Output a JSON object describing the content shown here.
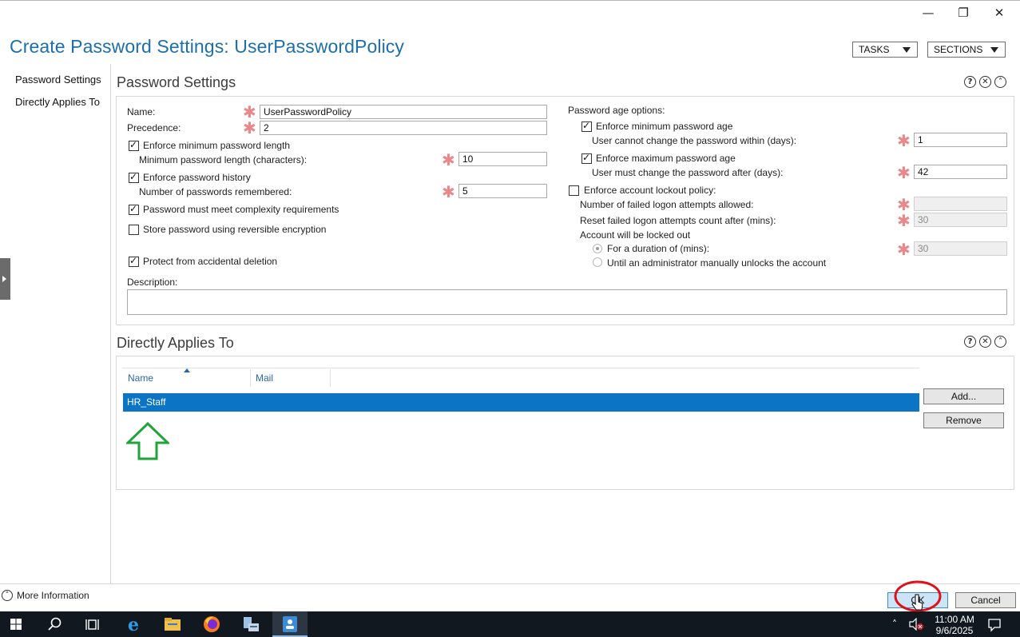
{
  "window": {
    "title": "Create Password Settings: UserPasswordPolicy",
    "minimize_glyph": "—",
    "restore_glyph": "❐",
    "close_glyph": "✕",
    "tasks_label": "TASKS",
    "sections_label": "SECTIONS"
  },
  "nav": {
    "items": [
      {
        "label": "Password Settings"
      },
      {
        "label": "Directly Applies To"
      }
    ]
  },
  "password_settings": {
    "title": "Password Settings",
    "name_label": "Name:",
    "name_value": "UserPasswordPolicy",
    "precedence_label": "Precedence:",
    "precedence_value": "2",
    "enforce_min_length_label": "Enforce minimum password length",
    "enforce_min_length_checked": true,
    "min_length_label": "Minimum password length (characters):",
    "min_length_value": "10",
    "enforce_history_label": "Enforce password history",
    "enforce_history_checked": true,
    "history_label": "Number of passwords remembered:",
    "history_value": "5",
    "complexity_label": "Password must meet complexity requirements",
    "complexity_checked": true,
    "reversible_label": "Store password using reversible encryption",
    "reversible_checked": false,
    "protect_label": "Protect from accidental deletion",
    "protect_checked": true,
    "description_label": "Description:",
    "description_value": "",
    "age_options_label": "Password age options:",
    "enforce_min_age_label": "Enforce minimum password age",
    "enforce_min_age_checked": true,
    "min_age_label": "User cannot change the password within (days):",
    "min_age_value": "1",
    "enforce_max_age_label": "Enforce maximum password age",
    "enforce_max_age_checked": true,
    "max_age_label": "User must change the password after (days):",
    "max_age_value": "42",
    "lockout_label": "Enforce account lockout policy:",
    "lockout_checked": false,
    "failed_attempts_label": "Number of failed logon attempts allowed:",
    "failed_attempts_value": "",
    "reset_label": "Reset failed logon attempts count after (mins):",
    "reset_value": "30",
    "locked_out_label": "Account will be locked out",
    "duration_label": "For a duration of (mins):",
    "duration_value": "30",
    "duration_selected": true,
    "manual_unlock_label": "Until an administrator manually unlocks the account",
    "required_glyph": "✱"
  },
  "applies_to": {
    "title": "Directly Applies To",
    "columns": [
      "Name",
      "Mail"
    ],
    "rows": [
      {
        "name": "HR_Staff",
        "mail": ""
      }
    ],
    "add_label": "Add...",
    "remove_label": "Remove"
  },
  "footer": {
    "more_info_label": "More Information",
    "ok_label": "OK",
    "cancel_label": "Cancel"
  },
  "taskbar": {
    "time": "11:00 AM",
    "date": "9/6/2025"
  },
  "colors": {
    "title_blue": "#1d6fa8",
    "selection_blue": "#0b74c4",
    "required_star": "#e8888b",
    "annotation_green": "#1fa33a",
    "annotation_red": "#e0101b"
  }
}
